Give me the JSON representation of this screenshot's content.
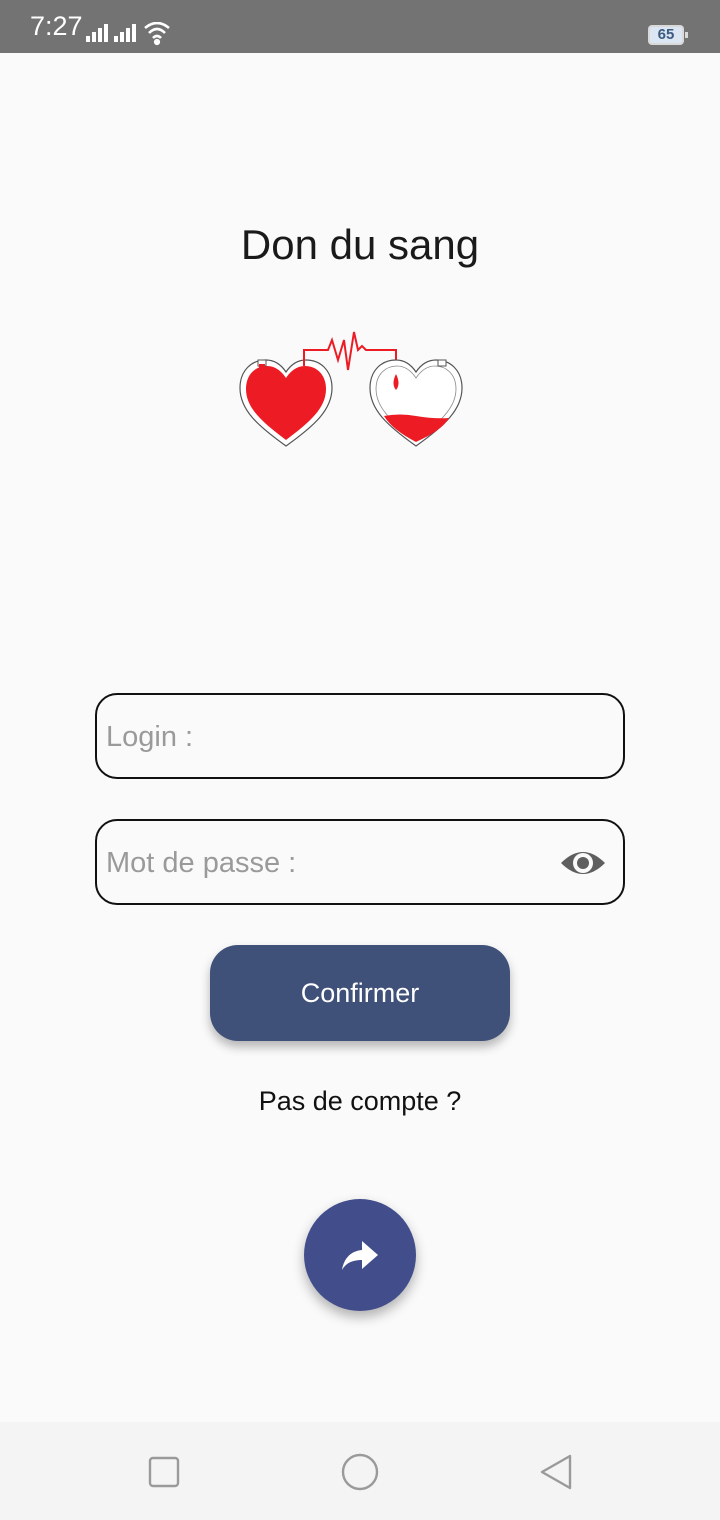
{
  "status_bar": {
    "time": "7:27",
    "battery": "65",
    "icons": [
      "signal-icon",
      "signal-icon",
      "wifi-icon",
      "battery-icon"
    ]
  },
  "app": {
    "title": "Don du sang",
    "logo_icon": "blood-donation-hearts-icon"
  },
  "form": {
    "login_placeholder": "Login :",
    "login_value": "",
    "password_placeholder": "Mot de passe :",
    "password_value": "",
    "password_toggle_icon": "eye-icon",
    "confirm_label": "Confirmer",
    "no_account_link": "Pas de compte ?",
    "fab_icon": "share-arrow-icon"
  },
  "nav_bar": {
    "icons": [
      "recent-apps-icon",
      "home-icon",
      "back-icon"
    ]
  },
  "colors": {
    "primary": "#3f5079",
    "fab": "#424e8c",
    "blood_red": "#ed1c24",
    "status_bar": "#737373",
    "background": "#fafafa"
  }
}
